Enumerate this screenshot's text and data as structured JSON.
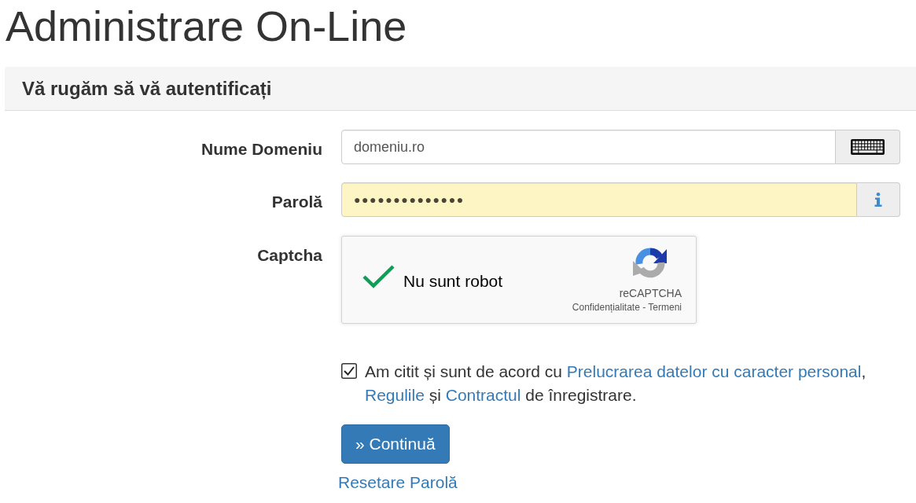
{
  "page_title": "Administrare On-Line",
  "panel": {
    "heading": "Vă rugăm să vă autentificați"
  },
  "fields": [
    {
      "kind": "text",
      "label": "Nume Domeniu",
      "value": "domeniu.ro",
      "autofilled": false
    },
    {
      "kind": "password",
      "label": "Parolă",
      "value": "●●●●●●●●●●●●●●",
      "autofilled": true
    }
  ],
  "captcha": {
    "label": "Captcha",
    "checked": true,
    "prompt": "Nu sunt robot",
    "brand": "reCAPTCHA",
    "privacy_link": "Confidențialitate",
    "separator": "-",
    "terms_link": "Termeni"
  },
  "agreement": {
    "checked": true,
    "parts": [
      {
        "kind": "text",
        "text": "Am citit și sunt de acord cu "
      },
      {
        "kind": "link",
        "text": "Prelucrarea datelor cu caracter personal"
      },
      {
        "kind": "text",
        "text": ", "
      },
      {
        "kind": "link",
        "text": "Regulile"
      },
      {
        "kind": "text",
        "text": " și "
      },
      {
        "kind": "link",
        "text": "Contractul"
      },
      {
        "kind": "text",
        "text": " de înregistrare."
      }
    ]
  },
  "submit_button": "» Continuă",
  "reset_link": "Resetare Parolă"
}
